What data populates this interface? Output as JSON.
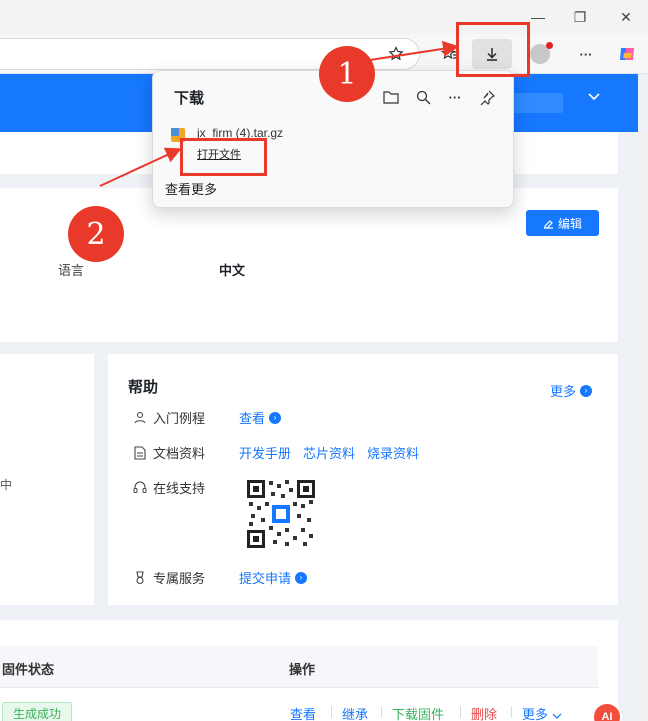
{
  "browser": {
    "minimize": "—",
    "restore": "❐",
    "close": "✕",
    "more": "···"
  },
  "downloads": {
    "title": "下载",
    "file_name": "jx_firm (4).tar.gz",
    "open_file": "打开文件",
    "see_more": "查看更多"
  },
  "settings": {
    "edit_label": "编辑",
    "lang_label": "语言",
    "lang_value": "中文"
  },
  "left_card": {
    "fragment": "中"
  },
  "help": {
    "title": "帮助",
    "more": "更多",
    "rows": [
      {
        "label": "入门例程",
        "links": [
          "查看"
        ]
      },
      {
        "label": "文档资料",
        "links": [
          "开发手册",
          "芯片资料",
          "烧录资料"
        ]
      },
      {
        "label": "在线支持",
        "links": []
      },
      {
        "label": "专属服务",
        "links": [
          "提交申请"
        ]
      }
    ]
  },
  "table": {
    "col_status": "固件状态",
    "col_ops": "操作",
    "status": "生成成功",
    "ops": {
      "view": "查看",
      "inherit": "继承",
      "download": "下载固件",
      "delete": "删除",
      "more": "更多"
    },
    "ai_label": "AI"
  },
  "annotations": {
    "one": "1",
    "two": "2"
  },
  "colors": {
    "accent": "#1677ff",
    "annotation": "#e8392b",
    "success": "#38b35e",
    "danger": "#e84a4a"
  }
}
